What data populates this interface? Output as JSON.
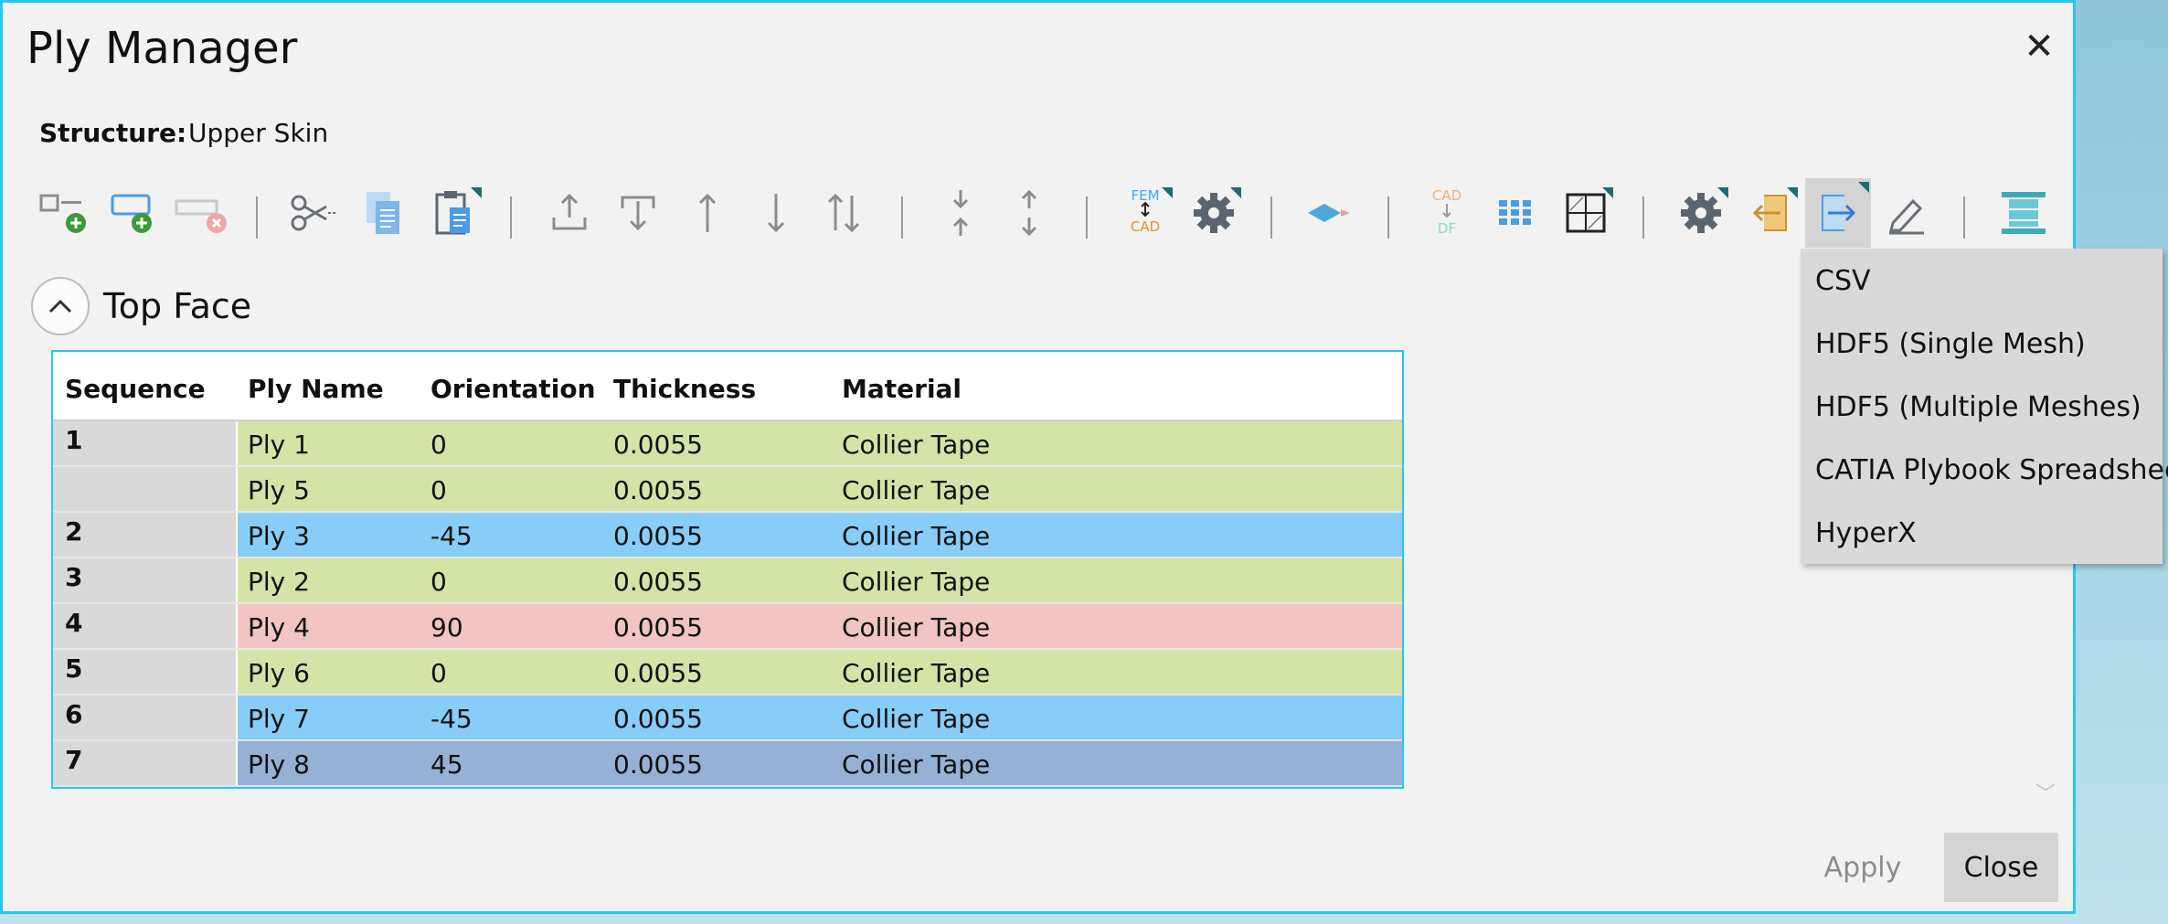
{
  "dialog": {
    "title": "Ply Manager",
    "close_icon": "close-icon",
    "structure_label": "Structure:",
    "structure_value": "Upper Skin"
  },
  "toolbar": {
    "buttons": [
      {
        "name": "add-ply-button",
        "icon": "add-ply-icon"
      },
      {
        "name": "add-group-button",
        "icon": "add-group-icon"
      },
      {
        "name": "remove-ply-button",
        "icon": "remove-ply-icon"
      },
      {
        "name": "cut-button",
        "icon": "scissors-icon"
      },
      {
        "name": "copy-button",
        "icon": "copy-icon"
      },
      {
        "name": "paste-button",
        "icon": "paste-icon"
      },
      {
        "name": "move-to-top-button",
        "icon": "move-top-icon"
      },
      {
        "name": "move-to-bottom-button",
        "icon": "move-bottom-icon"
      },
      {
        "name": "move-up-button",
        "icon": "arrow-up-icon"
      },
      {
        "name": "move-down-button",
        "icon": "arrow-down-icon"
      },
      {
        "name": "swap-button",
        "icon": "swap-icon"
      },
      {
        "name": "merge-sequence-button",
        "icon": "merge-icon"
      },
      {
        "name": "split-sequence-button",
        "icon": "split-icon"
      },
      {
        "name": "fem-cad-button",
        "icon": "fem-cad-icon",
        "top": "FEM",
        "bottom": "CAD"
      },
      {
        "name": "settings-button",
        "icon": "gear-icon"
      },
      {
        "name": "layer-button",
        "icon": "layer-icon"
      },
      {
        "name": "cad-df-button",
        "icon": "cad-df-icon",
        "top": "CAD",
        "bottom": "DF"
      },
      {
        "name": "grid-view-button",
        "icon": "grid-icon"
      },
      {
        "name": "table-view-button",
        "icon": "table-icon"
      },
      {
        "name": "options-button",
        "icon": "gear-icon"
      },
      {
        "name": "import-button",
        "icon": "import-icon"
      },
      {
        "name": "export-button",
        "icon": "export-icon"
      },
      {
        "name": "edit-button",
        "icon": "pencil-icon"
      },
      {
        "name": "stack-view-button",
        "icon": "stack-icon"
      }
    ]
  },
  "section": {
    "title": "Top Face",
    "toggle_icon": "chevron-up-icon"
  },
  "table": {
    "headers": [
      "Sequence",
      "Ply Name",
      "Orientation",
      "Thickness",
      "Material"
    ],
    "rows": [
      {
        "sequence": "1",
        "ply": "Ply 1",
        "orientation": "0",
        "thickness": "0.0055",
        "material": "Collier Tape",
        "color": "#d4e3a6"
      },
      {
        "sequence": "",
        "ply": "Ply 5",
        "orientation": "0",
        "thickness": "0.0055",
        "material": "Collier Tape",
        "color": "#d4e3a6"
      },
      {
        "sequence": "2",
        "ply": "Ply 3",
        "orientation": "-45",
        "thickness": "0.0055",
        "material": "Collier Tape",
        "color": "#87cdf8"
      },
      {
        "sequence": "3",
        "ply": "Ply 2",
        "orientation": "0",
        "thickness": "0.0055",
        "material": "Collier Tape",
        "color": "#d4e3a6"
      },
      {
        "sequence": "4",
        "ply": "Ply 4",
        "orientation": "90",
        "thickness": "0.0055",
        "material": "Collier Tape",
        "color": "#f2c4c4"
      },
      {
        "sequence": "5",
        "ply": "Ply 6",
        "orientation": "0",
        "thickness": "0.0055",
        "material": "Collier Tape",
        "color": "#d4e3a6"
      },
      {
        "sequence": "6",
        "ply": "Ply 7",
        "orientation": "-45",
        "thickness": "0.0055",
        "material": "Collier Tape",
        "color": "#87cdf8"
      },
      {
        "sequence": "7",
        "ply": "Ply 8",
        "orientation": "45",
        "thickness": "0.0055",
        "material": "Collier Tape",
        "color": "#95b1d6"
      }
    ]
  },
  "export_menu": {
    "items": [
      "CSV",
      "HDF5 (Single Mesh)",
      "HDF5 (Multiple Meshes)",
      "CATIA Plybook Spreadsheet",
      "HyperX"
    ]
  },
  "footer": {
    "apply_label": "Apply",
    "close_label": "Close"
  },
  "colors": {
    "accent": "#28c6f0",
    "icon_gray": "#8c8c8c",
    "icon_blue": "#4a9be8",
    "icon_dark": "#5a6570",
    "icon_orange": "#e8a23c"
  }
}
